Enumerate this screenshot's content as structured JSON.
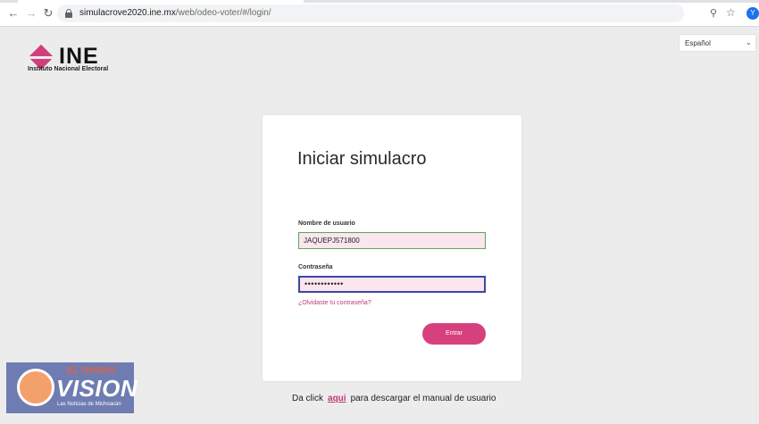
{
  "browser": {
    "url_host": "simulacrove2020.ine.mx",
    "url_path": "/web/odeo-voter/#/login/",
    "profile_initial": "Y",
    "icons": [
      "back-icon",
      "forward-icon",
      "reload-icon",
      "lock-icon",
      "key-icon",
      "star-icon"
    ]
  },
  "header": {
    "logo_text": "INE",
    "logo_subtitle": "Instituto Nacional Electoral",
    "language": "Español"
  },
  "login": {
    "title": "Iniciar simulacro",
    "username_label": "Nombre de usuario",
    "username_value": "JAQUEPJ571800",
    "password_label": "Contraseña",
    "password_value": "••••••••••••",
    "forgot_link": "¿Olvidaste tu contraseña?",
    "submit_label": "Entrar"
  },
  "footer": {
    "manual_before": "Da click",
    "manual_link": "aqui",
    "manual_after": "para descargar el manual de usuario"
  },
  "watermark": {
    "line1": "EL DIARIO",
    "line2": "VISION",
    "line3": "Las Noticias de Michoacán"
  },
  "colors": {
    "brand": "#d6407d",
    "page_bg": "#ececec",
    "field_bg": "#fbe5ef",
    "focus_border": "#3b4a9e"
  }
}
